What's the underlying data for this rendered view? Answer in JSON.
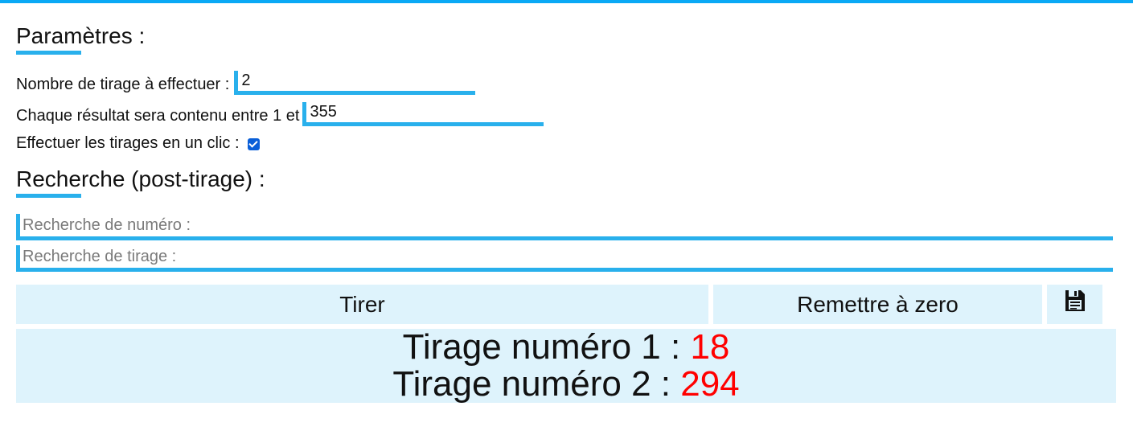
{
  "params": {
    "title": "Paramètres :",
    "count_label": "Nombre de tirage à effectuer :",
    "count_value": "2",
    "range_label": "Chaque résultat sera contenu entre 1 et",
    "range_value": "355",
    "oneclick_label": "Effectuer les tirages en un clic :",
    "oneclick_checked": true
  },
  "search": {
    "title": "Recherche (post-tirage) :",
    "number_placeholder": "Recherche de numéro :",
    "draw_placeholder": "Recherche de tirage :"
  },
  "actions": {
    "draw_label": "Tirer",
    "reset_label": "Remettre à zero",
    "save_icon": "floppy-disk-icon"
  },
  "results": [
    {
      "label": "Tirage numéro 1 :",
      "value": "18"
    },
    {
      "label": "Tirage numéro 2 :",
      "value": "294"
    }
  ],
  "colors": {
    "accent": "#29b0ec",
    "top_border": "#0aa9f5",
    "panel_bg": "#def3fc",
    "result_value": "#ff0000",
    "checkbox": "#0a5fd8"
  }
}
